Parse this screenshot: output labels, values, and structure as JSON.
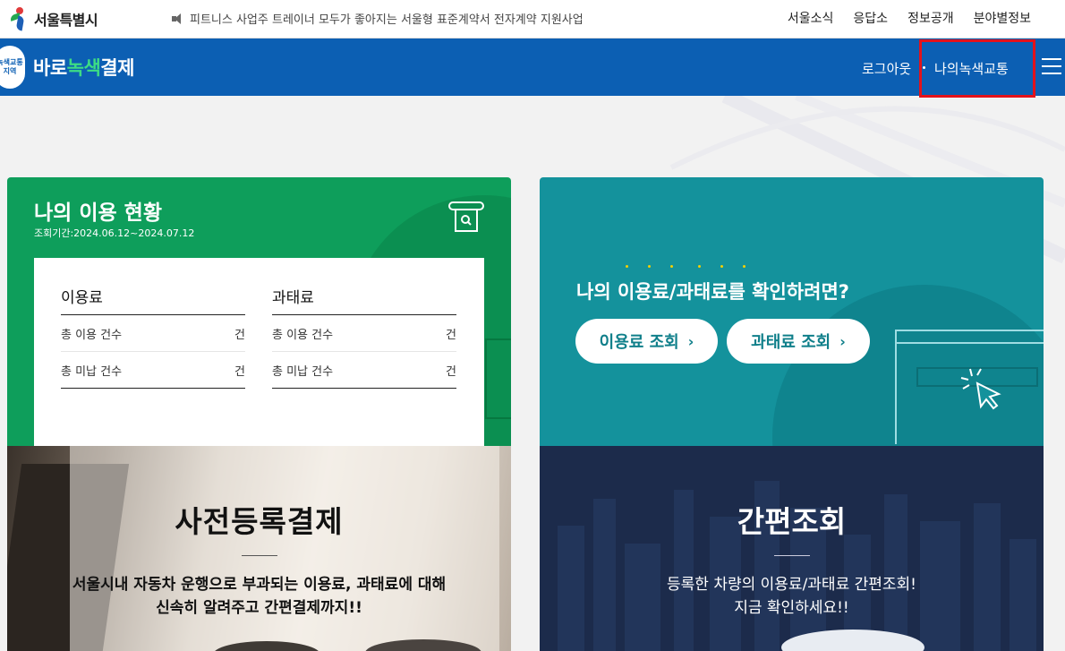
{
  "topbar": {
    "logo_text": "서울특별시",
    "notice": "피트니스 사업주 트레이너 모두가 좋아지는 서울형 표준계약서 전자계약 지원사업",
    "links": [
      "서울소식",
      "응답소",
      "정보공개",
      "분야별정보"
    ]
  },
  "header": {
    "badge_line1": "녹색교통",
    "badge_line2": "지역",
    "brand_prefix": "바로",
    "brand_highlight": "녹색",
    "brand_suffix": "결제",
    "logout": "로그아웃",
    "my_green": "나의녹색교통"
  },
  "usage": {
    "title": "나의 이용 현황",
    "period": "조회기간:2024.06.12~2024.07.12",
    "fee": {
      "heading": "이용료",
      "rows": [
        {
          "label": "총 이용 건수",
          "unit": "건"
        },
        {
          "label": "총 미납 건수",
          "unit": "건"
        }
      ]
    },
    "fine": {
      "heading": "과태료",
      "rows": [
        {
          "label": "총 이용 건수",
          "unit": "건"
        },
        {
          "label": "총 미납 건수",
          "unit": "건"
        }
      ]
    }
  },
  "check": {
    "title": "나의 이용료/과태료를 확인하려면?",
    "fee_button": "이용료 조회",
    "fine_button": "과태료 조회",
    "chevron": "›"
  },
  "prereg": {
    "title": "사전등록결제",
    "desc_line1": "서울시내 자동차 운행으로 부과되는 이용료, 과태료에 대해",
    "desc_line2": "신속히 알려주고 간편결제까지!!"
  },
  "quick": {
    "title": "간편조회",
    "desc_line1": "등록한 차량의 이용료/과태료 간편조회!",
    "desc_line2": "지금 확인하세요!!"
  },
  "colors": {
    "header_blue": "#0c5fb3",
    "usage_green": "#0e9e5b",
    "check_teal": "#14929c",
    "highlight_red": "#e3121b"
  }
}
